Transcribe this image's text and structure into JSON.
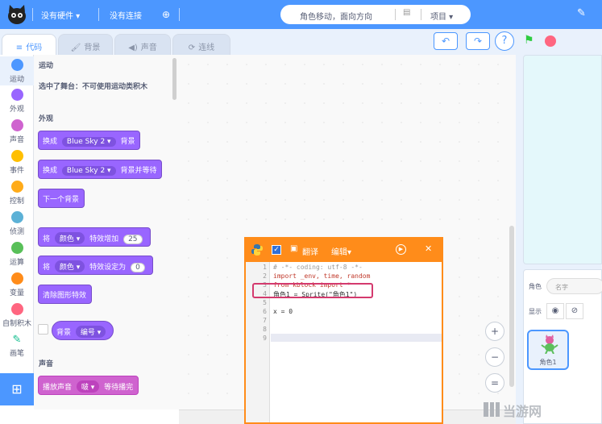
{
  "topbar": {
    "hardware": "没有硬件",
    "connection": "没有连接",
    "title": "角色移动，面向方向",
    "project_menu": "项目"
  },
  "tabs": [
    {
      "label": "代码",
      "icon": "code-icon"
    },
    {
      "label": "背景",
      "icon": "brush-icon"
    },
    {
      "label": "声音",
      "icon": "speaker-icon"
    },
    {
      "label": "连线",
      "icon": "wire-icon"
    }
  ],
  "controls": {
    "undo": "↶",
    "redo": "↷",
    "help": "?"
  },
  "categories": [
    {
      "label": "运动",
      "color": "#4c97ff"
    },
    {
      "label": "外观",
      "color": "#9966ff"
    },
    {
      "label": "声音",
      "color": "#cf63cf"
    },
    {
      "label": "事件",
      "color": "#ffbf00"
    },
    {
      "label": "控制",
      "color": "#ffab19"
    },
    {
      "label": "侦测",
      "color": "#5cb1d6"
    },
    {
      "label": "运算",
      "color": "#59c059"
    },
    {
      "label": "变量",
      "color": "#ff8c1a"
    },
    {
      "label": "自制积木",
      "color": "#ff6680"
    },
    {
      "label": "画笔",
      "color": "#0fbd8c"
    }
  ],
  "palette": {
    "motion_title": "运动",
    "motion_note": "选中了舞台：不可使用运动类积木",
    "looks_title": "外观",
    "blocks": {
      "switch_backdrop": {
        "prefix": "换成",
        "value": "Blue Sky 2",
        "suffix": "背景"
      },
      "switch_backdrop_wait": {
        "prefix": "换成",
        "value": "Blue Sky 2",
        "suffix": "背景并等待"
      },
      "next_backdrop": "下一个背景",
      "change_effect": {
        "prefix": "将",
        "effect": "颜色",
        "mid": "特效增加",
        "value": "25"
      },
      "set_effect": {
        "prefix": "将",
        "effect": "颜色",
        "mid": "特效设定为",
        "value": "0"
      },
      "clear_effects": "清除图形特效",
      "backdrop_reporter": {
        "label": "背景",
        "value": "编号"
      }
    },
    "sound_title": "声音",
    "sound_block": {
      "prefix": "播放声音",
      "value": "啵",
      "suffix": "等待播完"
    }
  },
  "code_window": {
    "translate_label": "翻译",
    "edit_label": "编辑",
    "line_numbers": [
      "1",
      "2",
      "3",
      "4",
      "5",
      "6",
      "7",
      "8",
      "9"
    ],
    "lines": [
      "# -*- coding: utf-8 -*-",
      "import _env, time, random",
      "from kblock import *",
      "角色1 = Sprite(\"角色1\")",
      "",
      "x = 0",
      "",
      "",
      ""
    ]
  },
  "zoom": {
    "in": "+",
    "out": "−",
    "reset": "="
  },
  "sprite_panel": {
    "sprite_label": "角色",
    "name_placeholder": "名字",
    "show_label": "显示",
    "sprite_name": "角色1"
  },
  "watermark": "当游网",
  "colors": {
    "primary": "#4c97ff",
    "looks": "#9966ff",
    "sound": "#cf63cf",
    "code_window_border": "#ff8c1a",
    "highlight": "#d43a6e"
  }
}
